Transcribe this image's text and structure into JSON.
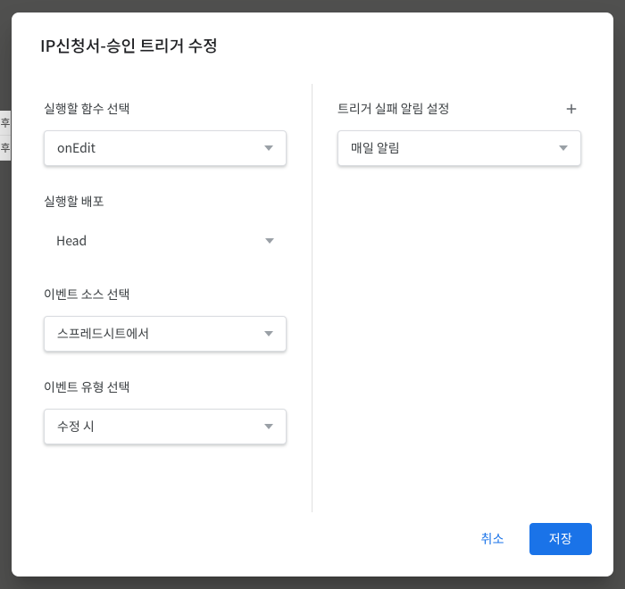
{
  "bg": {
    "r1": "후",
    "r2": "후"
  },
  "dialog": {
    "title": "IP신청서-승인 트리거 수정"
  },
  "left": {
    "fn": {
      "label": "실행할 함수 선택",
      "value": "onEdit"
    },
    "deploy": {
      "label": "실행할 배포",
      "value": "Head"
    },
    "source": {
      "label": "이벤트 소스 선택",
      "value": "스프레드시트에서"
    },
    "eventType": {
      "label": "이벤트 유형 선택",
      "value": "수정 시"
    }
  },
  "right": {
    "failure": {
      "label": "트리거 실패 알림 설정",
      "value": "매일 알림"
    }
  },
  "footer": {
    "cancel": "취소",
    "save": "저장"
  }
}
